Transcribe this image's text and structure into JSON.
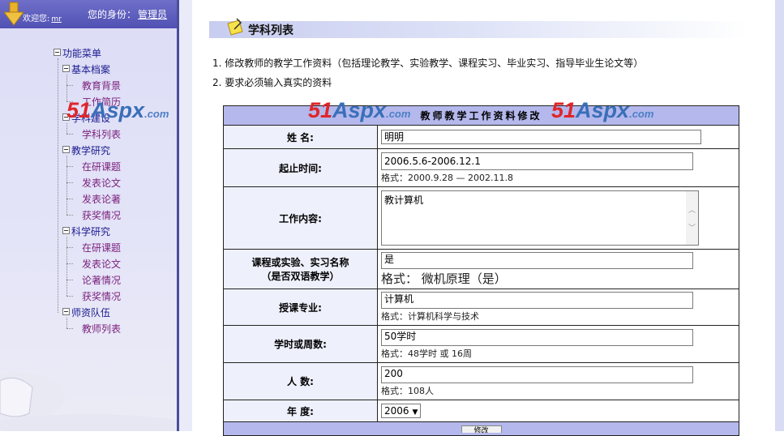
{
  "sidebar": {
    "welcome": "欢迎您:",
    "username": "mr",
    "identity_label": "您的身份：",
    "role": "管理员",
    "tree": {
      "root": "功能菜单",
      "cat_basic": "基本档案",
      "leaf_edu": "教育背景",
      "leaf_work": "工作简历",
      "cat_subject": "学科建设",
      "leaf_subject_list": "学科列表",
      "cat_teach": "教学研究",
      "leaf_teach_topic": "在研课题",
      "leaf_teach_paper": "发表论文",
      "leaf_teach_book": "发表论著",
      "leaf_teach_award": "获奖情况",
      "cat_sci": "科学研究",
      "leaf_sci_topic": "在研课题",
      "leaf_sci_paper": "发表论文",
      "leaf_sci_book": "论著情况",
      "leaf_sci_award": "获奖情况",
      "cat_staff": "师资队伍",
      "leaf_teacher_list": "教师列表"
    },
    "watermark": {
      "num": "51",
      "asp": "Aspx",
      "com": ".com"
    }
  },
  "main": {
    "title": "学科列表",
    "instructions": [
      "1.  修改教师的教学工作资料（包括理论教学、实验教学、课程实习、毕业实习、指导毕业生论文等）",
      "2.  要求必须输入真实的资料"
    ],
    "form": {
      "header": "教师教学工作资料修改",
      "name_label": "姓  名:",
      "name_value": "明明",
      "period_label": "起止时间:",
      "period_value": "2006.5.6-2006.12.1",
      "period_hint": "格式：2000.9.28 — 2002.11.8",
      "content_label": "工作内容:",
      "content_value": "教计算机",
      "course_label": "课程或实验、实习名称",
      "course_label2": "（是否双语教学）",
      "course_value": "是",
      "course_hint": "格式：  微机原理（是）",
      "major_label": "授课专业:",
      "major_value": "计算机",
      "major_hint": "格式：计算机科学与技术",
      "hours_label": "学时或周数:",
      "hours_value": "50学时",
      "hours_hint": "格式：48学时 或 16周",
      "people_label": "人 数:",
      "people_value": "200",
      "people_hint": "格式：108人",
      "year_label": "年  度:",
      "year_value": "2006",
      "submit_label": "修改"
    }
  },
  "colors": {
    "header_bg": "#5151b4",
    "sidebar_bg": "#dcdcf6",
    "table_header_bg": "#b4b8ec",
    "label_bg": "#eef0fb"
  }
}
